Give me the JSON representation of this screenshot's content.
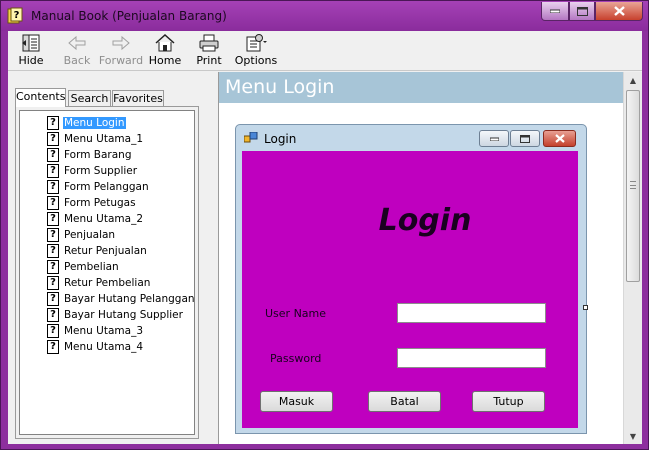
{
  "window": {
    "title": "Manual Book (Penjualan Barang)",
    "icon": "help-book-icon"
  },
  "toolbar": {
    "hide": "Hide",
    "back": "Back",
    "forward": "Forward",
    "home": "Home",
    "print": "Print",
    "options": "Options"
  },
  "tabs": {
    "contents": "Contents",
    "search": "Search",
    "favorites": "Favorites"
  },
  "tree": {
    "selected": "Menu Login",
    "items": [
      "Menu Login",
      "Menu Utama_1",
      "Form Barang",
      "Form Supplier",
      "Form Pelanggan",
      "Form Petugas",
      "Menu Utama_2",
      "Penjualan",
      "Retur Penjualan",
      "Pembelian",
      "Retur Pembelian",
      "Bayar Hutang Pelanggan",
      "Bayar Hutang Supplier",
      "Menu Utama_3",
      "Menu Utama_4"
    ]
  },
  "topic": {
    "title": "Menu Login",
    "header_color": "#a7c5d7"
  },
  "login_form": {
    "window_title": "Login",
    "heading": "Login",
    "username_label": "User Name",
    "password_label": "Password",
    "username_value": "",
    "password_value": "",
    "buttons": {
      "masuk": "Masuk",
      "batal": "Batal",
      "tutup": "Tutup"
    },
    "background_color": "#bf00bf"
  },
  "colors": {
    "frame": "#8d2f9e",
    "selection": "#3399ff"
  }
}
